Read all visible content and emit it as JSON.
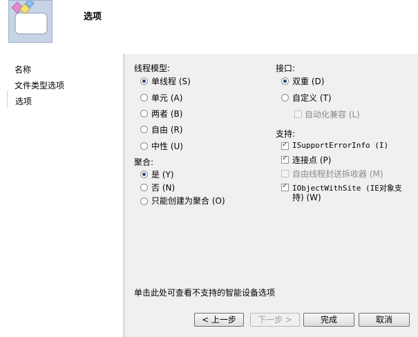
{
  "header": {
    "title": "选项"
  },
  "sidebar": {
    "items": [
      "名称",
      "文件类型选项",
      "选项"
    ]
  },
  "threading": {
    "label": "线程模型:",
    "options": [
      "单线程 (S)",
      "单元 (A)",
      "两者 (B)",
      "自由 (R)",
      "中性 (U)"
    ],
    "selected": "单线程 (S)"
  },
  "aggregation": {
    "label": "聚合:",
    "options": [
      "是 (Y)",
      "否 (N)",
      "只能创建为聚合 (O)"
    ],
    "selected": "是 (Y)"
  },
  "interface": {
    "label": "接口:",
    "options": [
      "双重 (D)",
      "自定义 (T)"
    ],
    "selected": "双重 (D)",
    "automation_compat": "自动化兼容 (L)"
  },
  "support": {
    "label": "支持:",
    "items": [
      {
        "label": "ISupportErrorInfo (I)",
        "checked": true,
        "enabled": true
      },
      {
        "label": "连接点 (P)",
        "checked": true,
        "enabled": true
      },
      {
        "label": "自由线程封送拆收器 (M)",
        "checked": false,
        "enabled": false
      },
      {
        "label": "IObjectWithSite (IE对象支",
        "label_line2": "持) (W)",
        "checked": true,
        "enabled": true
      }
    ]
  },
  "footer_link": "单击此处可查看不支持的智能设备选项",
  "buttons": {
    "back": "< 上一步",
    "next": "下一步 >",
    "finish": "完成",
    "cancel": "取消"
  }
}
